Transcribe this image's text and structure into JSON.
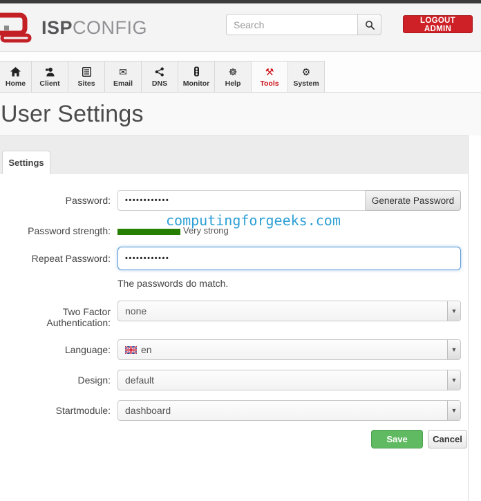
{
  "header": {
    "brand_bold": "ISP",
    "brand_light": "CONFIG",
    "logo_icon": "ispconfig-monitor-logo",
    "search_placeholder": "Search",
    "search_icon": "magnifier-icon",
    "logout_label": "LOGOUT ADMIN"
  },
  "nav": {
    "items": [
      {
        "label": "Home",
        "icon": "home-icon"
      },
      {
        "label": "Client",
        "icon": "client-icon"
      },
      {
        "label": "Sites",
        "icon": "sites-icon"
      },
      {
        "label": "Email",
        "icon": "email-icon",
        "glyph": "✉"
      },
      {
        "label": "DNS",
        "icon": "dns-icon"
      },
      {
        "label": "Monitor",
        "icon": "monitor-icon"
      },
      {
        "label": "Help",
        "icon": "help-icon",
        "glyph": "☸"
      },
      {
        "label": "Tools",
        "icon": "tools-icon",
        "glyph": "⚒",
        "active": true
      },
      {
        "label": "System",
        "icon": "system-icon",
        "glyph": "⚙"
      }
    ]
  },
  "page": {
    "title": "User Settings"
  },
  "tabs": {
    "active": "Settings"
  },
  "form": {
    "password": {
      "label": "Password:",
      "masked_value": "••••••••••••",
      "generate_button": "Generate Password"
    },
    "watermark": {
      "text": "computingforgeeks.com",
      "color": "#2d9fd6"
    },
    "strength": {
      "label": "Password strength:",
      "level_text": "Very strong",
      "bar_color": "#267f00"
    },
    "repeat_password": {
      "label": "Repeat Password:",
      "masked_value": "••••••••••••",
      "focused": true
    },
    "match_message": "The passwords do match.",
    "two_factor": {
      "label": "Two Factor Authentication:",
      "value": "none"
    },
    "language": {
      "label": "Language:",
      "value": "en",
      "flag_icon": "uk-flag-icon"
    },
    "design": {
      "label": "Design:",
      "value": "default"
    },
    "startmodule": {
      "label": "Startmodule:",
      "value": "dashboard"
    }
  },
  "actions": {
    "save": "Save",
    "cancel": "Cancel"
  },
  "ui": {
    "dropdown_arrow": "▼"
  },
  "colors": {
    "accent_red": "#cd2127",
    "save_green": "#60ba62",
    "focus_blue": "#5b9bd8",
    "strength_green": "#267f00",
    "watermark_blue": "#2d9fd6"
  }
}
